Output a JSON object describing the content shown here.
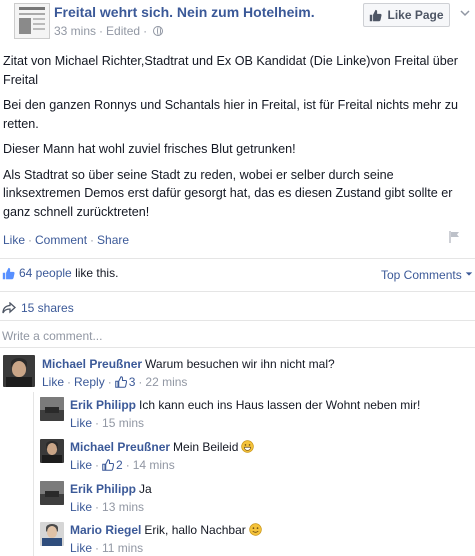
{
  "post": {
    "page_name": "Freital wehrt sich. Nein zum Hotelheim.",
    "time": "33 mins",
    "edited": "Edited",
    "like_page_label": "Like Page",
    "paragraphs": [
      "Zitat von Michael Richter,Stadtrat und Ex OB Kandidat (Die Linke)von Freital über Freital",
      "Bei den ganzen Ronnys und Schantals hier in Freital, ist für Freital nichts mehr zu retten.",
      "Dieser Mann hat wohl zuviel frisches Blut getrunken!",
      "Als Stadtrat so über seine Stadt zu reden, wobei er selber durch seine linksextremen Demos erst dafür gesorgt hat, das es diesen Zustand gibt sollte er ganz schnell zurücktreten!"
    ],
    "actions": {
      "like": "Like",
      "comment": "Comment",
      "share": "Share"
    },
    "likes_count": "64 people",
    "likes_suffix": "like this.",
    "top_comments_label": "Top Comments",
    "shares_label": "15 shares",
    "write_comment_placeholder": "Write a comment..."
  },
  "comments": [
    {
      "name": "Michael Preußner",
      "text": "Warum besuchen wir ihn nicht mal?",
      "like": "Like",
      "reply": "Reply",
      "likes": "3",
      "time": "22 mins"
    },
    {
      "name": "Erik Philipp",
      "text": "Ich kann euch ins Haus lassen der Wohnt neben mir!",
      "like": "Like",
      "time": "15 mins"
    },
    {
      "name": "Michael Preußner",
      "text": "Mein Beileid",
      "like": "Like",
      "likes": "2",
      "time": "14 mins"
    },
    {
      "name": "Erik Philipp",
      "text": "Ja",
      "like": "Like",
      "time": "13 mins"
    },
    {
      "name": "Mario Riegel",
      "text": "Erik, hallo Nachbar",
      "like": "Like",
      "time": "11 mins"
    }
  ],
  "colors": {
    "link": "#3b5998",
    "muted": "#9197a3",
    "divider": "#e5e5e5"
  },
  "icons": [
    "thumbs-up-icon",
    "globe-icon",
    "chevron-down-icon",
    "flag-icon",
    "share-arrow-icon",
    "smiley-icon",
    "grin-emoji-icon"
  ]
}
